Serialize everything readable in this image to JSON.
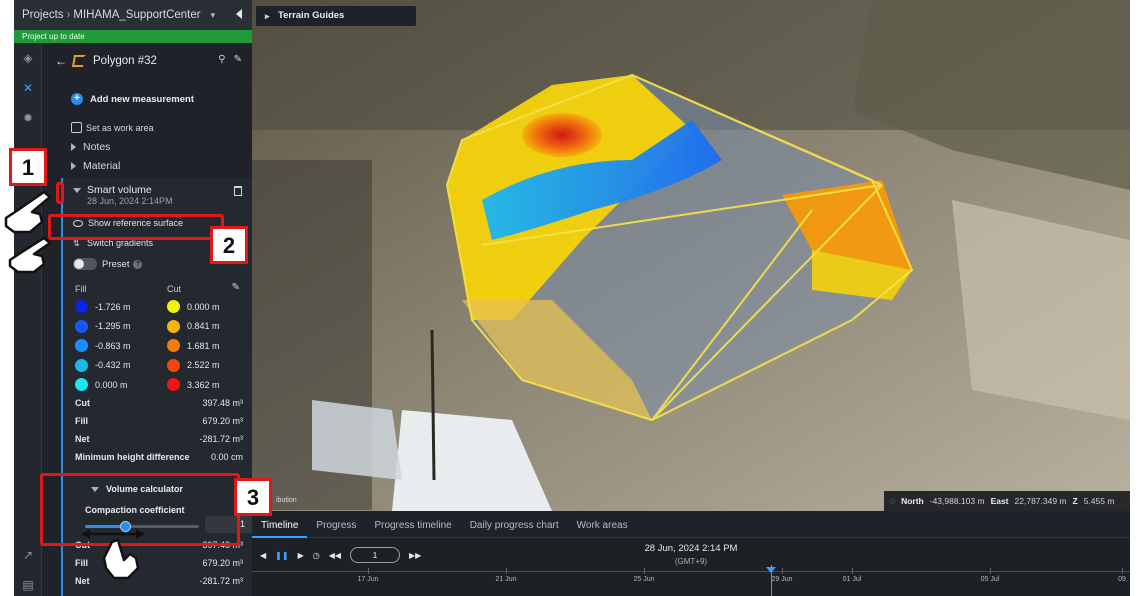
{
  "header": {
    "breadcrumb_root": "Projects",
    "breadcrumb_project": "MIHAMA_SupportCenter",
    "status": "Project up to date"
  },
  "panel": {
    "measurement_title": "Polygon #32",
    "add_measurement": "Add new measurement",
    "set_work_area": "Set as work area",
    "notes": "Notes",
    "material": "Material",
    "smart_volume": {
      "title": "Smart volume",
      "date": "28 Jun, 2024 2:14PM",
      "show_reference": "Show reference surface",
      "switch_gradients": "Switch gradients",
      "preset": "Preset",
      "fill_heading": "Fill",
      "cut_heading": "Cut",
      "fill_scale": [
        {
          "value": "-1.726 m",
          "color": "#0a23e6"
        },
        {
          "value": "-1.295 m",
          "color": "#1a56ff"
        },
        {
          "value": "-0.863 m",
          "color": "#1e8cff"
        },
        {
          "value": "-0.432 m",
          "color": "#1ab8f0"
        },
        {
          "value": "0.000 m",
          "color": "#1ae6f0"
        }
      ],
      "cut_scale": [
        {
          "value": "0.000 m",
          "color": "#f5f00a"
        },
        {
          "value": "0.841 m",
          "color": "#f5b40a"
        },
        {
          "value": "1.681 m",
          "color": "#f57a0a"
        },
        {
          "value": "2.522 m",
          "color": "#f5460a"
        },
        {
          "value": "3.362 m",
          "color": "#f01414"
        }
      ],
      "stats": {
        "cut_label": "Cut",
        "cut_value": "397.48 m³",
        "fill_label": "Fill",
        "fill_value": "679.20 m³",
        "net_label": "Net",
        "net_value": "-281.72 m³",
        "min_height_label": "Minimum height difference",
        "min_height_value": "0.00 cm"
      },
      "volume_calculator": {
        "title": "Volume calculator",
        "compaction_label": "Compaction coefficient",
        "compaction_value": "1",
        "slider_fraction": 0.35
      },
      "lower_stats": {
        "cut_label": "Cut",
        "cut_value": "397.48 m³",
        "fill_label": "Fill",
        "fill_value": "679.20 m³",
        "net_label": "Net",
        "net_value": "-281.72 m³"
      }
    }
  },
  "map": {
    "badge": "Terrain Guides",
    "attribution": "ibution",
    "coords": {
      "north_label": "North",
      "north_value": "-43,988.103 m",
      "east_label": "East",
      "east_value": "22,787.349 m",
      "z_label": "Z",
      "z_value": "5.455 m"
    }
  },
  "timeline": {
    "tabs": [
      "Timeline",
      "Progress",
      "Progress timeline",
      "Daily progress chart",
      "Work areas"
    ],
    "active_tab": 0,
    "step_value": "1",
    "current_date": "28 Jun, 2024 2:14 PM",
    "timezone": "(GMT+9)",
    "ticks": [
      "17 Jun",
      "21 Jun",
      "25 Jun",
      "29 Jun",
      "01 Jul",
      "05 Jul",
      "09"
    ]
  },
  "annotations": {
    "step1": "1",
    "step2": "2",
    "step3": "3"
  },
  "colors": {
    "accent": "#2b8de8",
    "status_green": "#1f9a39",
    "callout_red": "#e01818"
  }
}
